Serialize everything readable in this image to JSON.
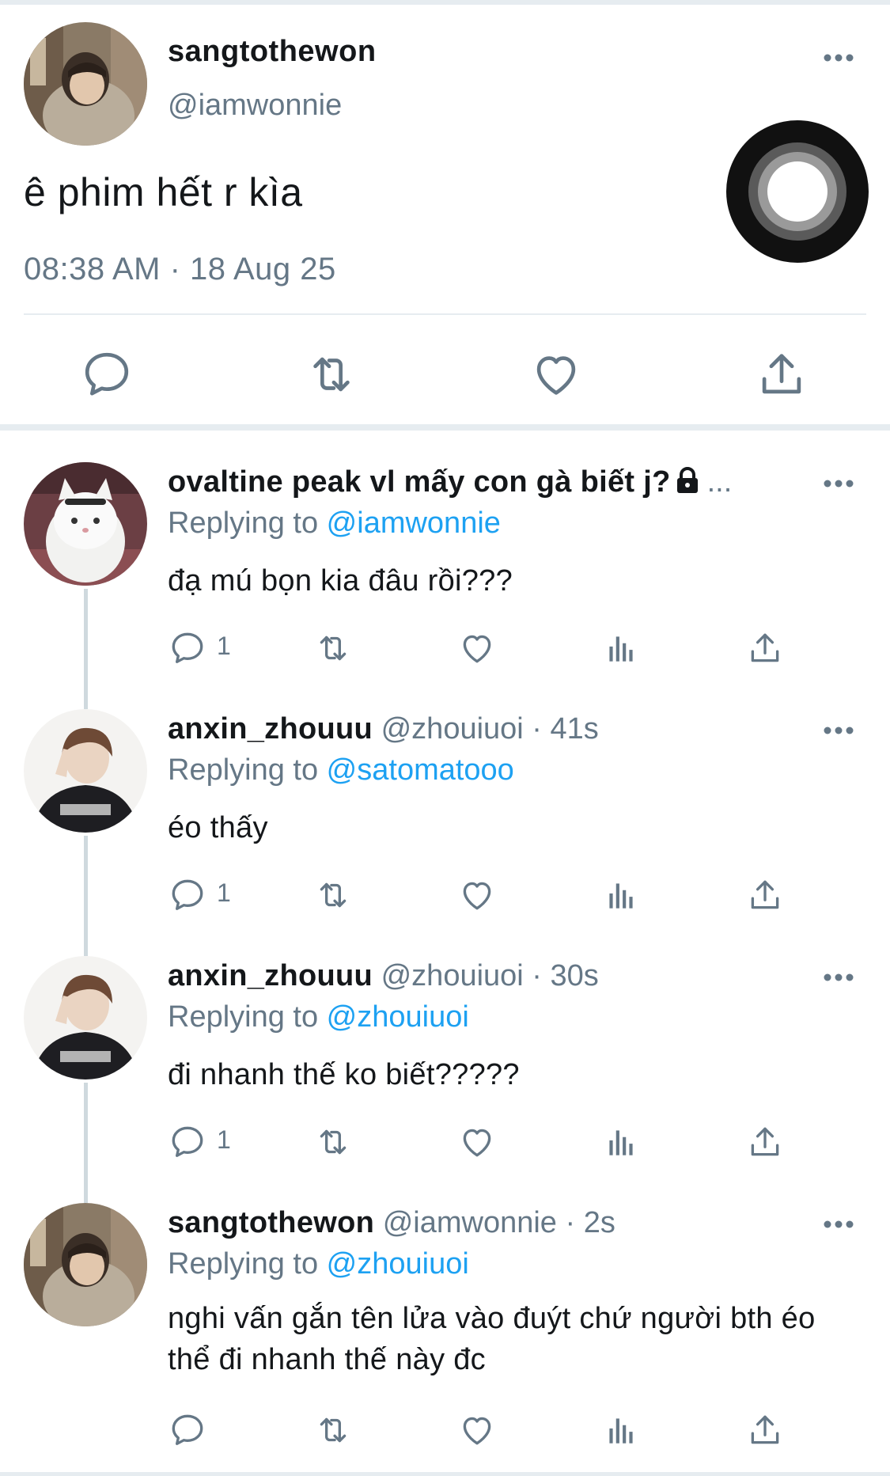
{
  "colors": {
    "link": "#1da1f2",
    "secondary_text": "#657786",
    "primary_text": "#14171a",
    "divider": "#e6ecf0"
  },
  "main_tweet": {
    "display_name": "sangtothewon",
    "handle": "@iamwonnie",
    "text": "ê phim hết r kìa",
    "meta": "08:38 AM · 18 Aug 25",
    "actions": [
      "reply-icon",
      "retweet-icon",
      "like-icon",
      "share-icon"
    ]
  },
  "replies": [
    {
      "display_name": "ovaltine peak vl mấy con gà biết j?",
      "locked": true,
      "ellipsis": "...",
      "handle": "",
      "time": "",
      "replying_prefix": "Replying to ",
      "replying_to": "@iamwonnie",
      "text": "đạ mú bọn kia đâu rồi???",
      "reply_count": "1"
    },
    {
      "display_name": "anxin_zhouuu",
      "handle": "@zhouiuoi",
      "time": "41s",
      "replying_prefix": "Replying to ",
      "replying_to": "@satomatooo",
      "text": "éo thấy",
      "reply_count": "1"
    },
    {
      "display_name": "anxin_zhouuu",
      "handle": "@zhouiuoi",
      "time": "30s",
      "replying_prefix": "Replying to ",
      "replying_to": "@zhouiuoi",
      "text": "đi nhanh thế ko biết?????",
      "reply_count": "1"
    },
    {
      "display_name": "sangtothewon",
      "handle": "@iamwonnie",
      "time": "2s",
      "replying_prefix": "Replying to ",
      "replying_to": "@zhouiuoi",
      "text": "nghi vấn gắn tên lửa vào đuýt chứ người bth éo thể đi nhanh thế này đc",
      "reply_count": ""
    }
  ],
  "separator": " · "
}
